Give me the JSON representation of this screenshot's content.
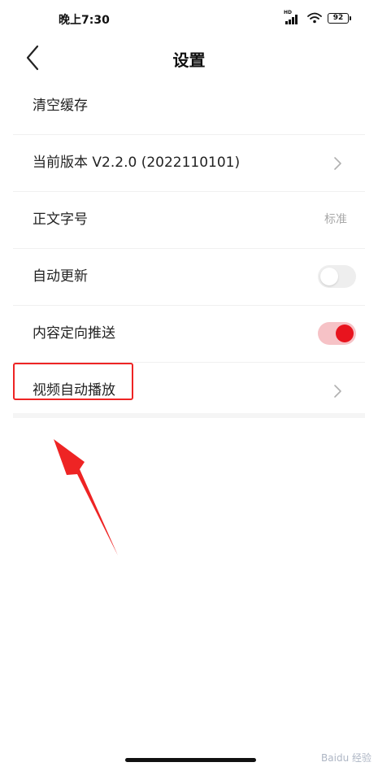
{
  "status_bar": {
    "time": "晚上7:30",
    "network_label": "HD",
    "battery_level": "92"
  },
  "header": {
    "title": "设置"
  },
  "settings": {
    "items": [
      {
        "label": "清空缓存"
      },
      {
        "label": "当前版本 V2.2.0 (2022110101)"
      },
      {
        "label": "正文字号",
        "value": "标准"
      },
      {
        "label": "自动更新",
        "toggle_on": false
      },
      {
        "label": "内容定向推送",
        "toggle_on": true
      },
      {
        "label": "视频自动播放"
      }
    ]
  },
  "colors": {
    "accent": "#e8141e",
    "toggle_on_track": "#f6c2c6",
    "toggle_off_track": "#eeeeee",
    "annotation": "#ee2424"
  },
  "watermark": "Baidu 经验"
}
